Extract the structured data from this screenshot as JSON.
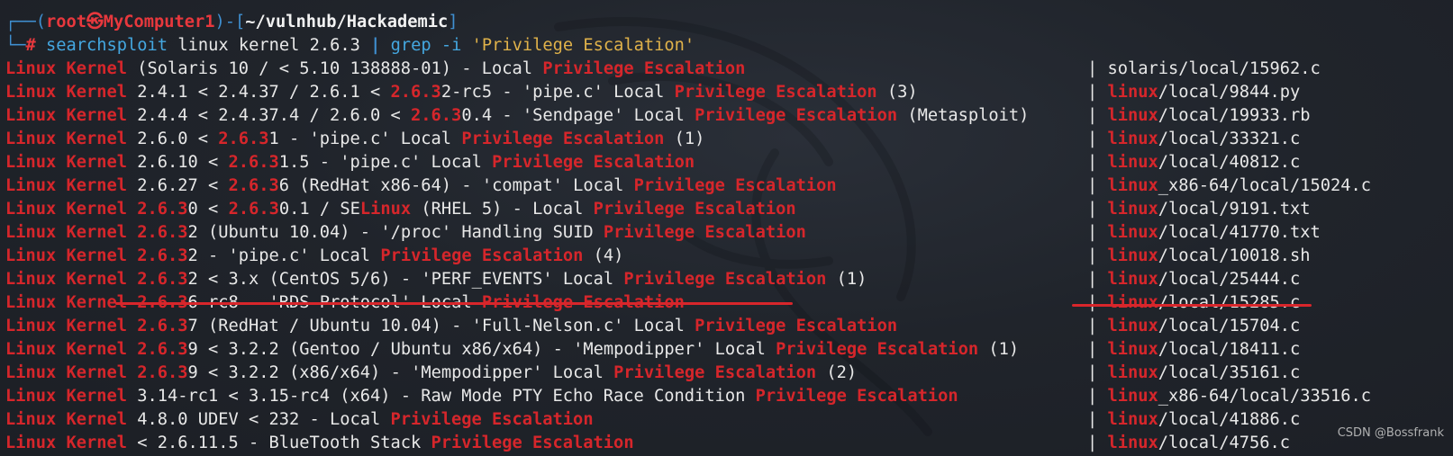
{
  "prompt": {
    "corner_top": "┌──(",
    "user": "root",
    "skull": "㉿",
    "host": "MyComputer1",
    "sep_open": ")-[",
    "cwd": "~/vulnhub/Hackademic",
    "sep_close": "]",
    "corner_bottom": "└─",
    "hash": "#",
    "command": "searchsploit",
    "args": " linux kernel 2.6.3 ",
    "pipe": "|",
    "grep": " grep -i ",
    "pattern": "'Privilege Escalation'"
  },
  "results": [
    {
      "title": [
        [
          "hl",
          "Linux Kernel"
        ],
        [
          "t",
          " (Solaris 10 / < 5.10 138888-01) - Local "
        ],
        [
          "hl",
          "Privilege Escalation"
        ]
      ],
      "path": [
        [
          "t",
          "| solaris/local/15962.c"
        ]
      ]
    },
    {
      "title": [
        [
          "hl",
          "Linux Kernel"
        ],
        [
          "t",
          " 2.4.1 < 2.4.37 / 2.6.1 < "
        ],
        [
          "hl",
          "2.6.3"
        ],
        [
          "t",
          "2-rc5 - 'pipe.c' Local "
        ],
        [
          "hl",
          "Privilege Escalation"
        ],
        [
          "t",
          " (3)"
        ]
      ],
      "path": [
        [
          "t",
          "| "
        ],
        [
          "hl",
          "linux"
        ],
        [
          "t",
          "/local/9844.py"
        ]
      ]
    },
    {
      "title": [
        [
          "hl",
          "Linux Kernel"
        ],
        [
          "t",
          " 2.4.4 < 2.4.37.4 / 2.6.0 < "
        ],
        [
          "hl",
          "2.6.3"
        ],
        [
          "t",
          "0.4 - 'Sendpage' Local "
        ],
        [
          "hl",
          "Privilege Escalation"
        ],
        [
          "t",
          " (Metasploit)"
        ]
      ],
      "path": [
        [
          "t",
          "| "
        ],
        [
          "hl",
          "linux"
        ],
        [
          "t",
          "/local/19933.rb"
        ]
      ]
    },
    {
      "title": [
        [
          "hl",
          "Linux Kernel"
        ],
        [
          "t",
          " 2.6.0 < "
        ],
        [
          "hl",
          "2.6.3"
        ],
        [
          "t",
          "1 - 'pipe.c' Local "
        ],
        [
          "hl",
          "Privilege Escalation"
        ],
        [
          "t",
          " (1)"
        ]
      ],
      "path": [
        [
          "t",
          "| "
        ],
        [
          "hl",
          "linux"
        ],
        [
          "t",
          "/local/33321.c"
        ]
      ]
    },
    {
      "title": [
        [
          "hl",
          "Linux Kernel"
        ],
        [
          "t",
          " 2.6.10 < "
        ],
        [
          "hl",
          "2.6.3"
        ],
        [
          "t",
          "1.5 - 'pipe.c' Local "
        ],
        [
          "hl",
          "Privilege Escalation"
        ]
      ],
      "path": [
        [
          "t",
          "| "
        ],
        [
          "hl",
          "linux"
        ],
        [
          "t",
          "/local/40812.c"
        ]
      ]
    },
    {
      "title": [
        [
          "hl",
          "Linux Kernel"
        ],
        [
          "t",
          " 2.6.27 < "
        ],
        [
          "hl",
          "2.6.3"
        ],
        [
          "t",
          "6 (RedHat x86-64) - 'compat' Local "
        ],
        [
          "hl",
          "Privilege Escalation"
        ]
      ],
      "path": [
        [
          "t",
          "| "
        ],
        [
          "hl",
          "linux"
        ],
        [
          "t",
          "_x86-64/local/15024.c"
        ]
      ]
    },
    {
      "title": [
        [
          "hl",
          "Linux Kernel"
        ],
        [
          "t",
          " "
        ],
        [
          "hl",
          "2.6.3"
        ],
        [
          "t",
          "0 < "
        ],
        [
          "hl",
          "2.6.3"
        ],
        [
          "t",
          "0.1 / SE"
        ],
        [
          "hl",
          "Linux"
        ],
        [
          "t",
          " (RHEL 5) - Local "
        ],
        [
          "hl",
          "Privilege Escalation"
        ]
      ],
      "path": [
        [
          "t",
          "| "
        ],
        [
          "hl",
          "linux"
        ],
        [
          "t",
          "/local/9191.txt"
        ]
      ]
    },
    {
      "title": [
        [
          "hl",
          "Linux Kernel"
        ],
        [
          "t",
          " "
        ],
        [
          "hl",
          "2.6.3"
        ],
        [
          "t",
          "2 (Ubuntu 10.04) - '/proc' Handling SUID "
        ],
        [
          "hl",
          "Privilege Escalation"
        ]
      ],
      "path": [
        [
          "t",
          "| "
        ],
        [
          "hl",
          "linux"
        ],
        [
          "t",
          "/local/41770.txt"
        ]
      ]
    },
    {
      "title": [
        [
          "hl",
          "Linux Kernel"
        ],
        [
          "t",
          " "
        ],
        [
          "hl",
          "2.6.3"
        ],
        [
          "t",
          "2 - 'pipe.c' Local "
        ],
        [
          "hl",
          "Privilege Escalation"
        ],
        [
          "t",
          " (4)"
        ]
      ],
      "path": [
        [
          "t",
          "| "
        ],
        [
          "hl",
          "linux"
        ],
        [
          "t",
          "/local/10018.sh"
        ]
      ]
    },
    {
      "title": [
        [
          "hl",
          "Linux Kernel"
        ],
        [
          "t",
          " "
        ],
        [
          "hl",
          "2.6.3"
        ],
        [
          "t",
          "2 < 3.x (CentOS 5/6) - 'PERF_EVENTS' Local "
        ],
        [
          "hl",
          "Privilege Escalation"
        ],
        [
          "t",
          " (1)"
        ]
      ],
      "path": [
        [
          "t",
          "| "
        ],
        [
          "hl",
          "linux"
        ],
        [
          "t",
          "/local/25444.c"
        ]
      ]
    },
    {
      "title": [
        [
          "hl",
          "Linux Kernel"
        ],
        [
          "t",
          " "
        ],
        [
          "hl",
          "2.6.3"
        ],
        [
          "t",
          "6-rc8 - 'RDS Protocol' Local "
        ],
        [
          "hl",
          "Privilege Escalation"
        ]
      ],
      "path": [
        [
          "t",
          "| "
        ],
        [
          "hl",
          "linux"
        ],
        [
          "t",
          "/local/15285.c"
        ]
      ]
    },
    {
      "title": [
        [
          "hl",
          "Linux Kernel"
        ],
        [
          "t",
          " "
        ],
        [
          "hl",
          "2.6.3"
        ],
        [
          "t",
          "7 (RedHat / Ubuntu 10.04) - 'Full-Nelson.c' Local "
        ],
        [
          "hl",
          "Privilege Escalation"
        ]
      ],
      "path": [
        [
          "t",
          "| "
        ],
        [
          "hl",
          "linux"
        ],
        [
          "t",
          "/local/15704.c"
        ]
      ]
    },
    {
      "title": [
        [
          "hl",
          "Linux Kernel"
        ],
        [
          "t",
          " "
        ],
        [
          "hl",
          "2.6.3"
        ],
        [
          "t",
          "9 < 3.2.2 (Gentoo / Ubuntu x86/x64) - 'Mempodipper' Local "
        ],
        [
          "hl",
          "Privilege Escalation"
        ],
        [
          "t",
          " (1)"
        ]
      ],
      "path": [
        [
          "t",
          "| "
        ],
        [
          "hl",
          "linux"
        ],
        [
          "t",
          "/local/18411.c"
        ]
      ]
    },
    {
      "title": [
        [
          "hl",
          "Linux Kernel"
        ],
        [
          "t",
          " "
        ],
        [
          "hl",
          "2.6.3"
        ],
        [
          "t",
          "9 < 3.2.2 (x86/x64) - 'Mempodipper' Local "
        ],
        [
          "hl",
          "Privilege Escalation"
        ],
        [
          "t",
          " (2)"
        ]
      ],
      "path": [
        [
          "t",
          "| "
        ],
        [
          "hl",
          "linux"
        ],
        [
          "t",
          "/local/35161.c"
        ]
      ]
    },
    {
      "title": [
        [
          "hl",
          "Linux Kernel"
        ],
        [
          "t",
          " 3.14-rc1 < 3.15-rc4 (x64) - Raw Mode PTY Echo Race Condition "
        ],
        [
          "hl",
          "Privilege Escalation"
        ]
      ],
      "path": [
        [
          "t",
          "| "
        ],
        [
          "hl",
          "linux"
        ],
        [
          "t",
          "_x86-64/local/33516.c"
        ]
      ]
    },
    {
      "title": [
        [
          "hl",
          "Linux Kernel"
        ],
        [
          "t",
          " 4.8.0 UDEV < 232 - Local "
        ],
        [
          "hl",
          "Privilege Escalation"
        ]
      ],
      "path": [
        [
          "t",
          "| "
        ],
        [
          "hl",
          "linux"
        ],
        [
          "t",
          "/local/41886.c"
        ]
      ]
    },
    {
      "title": [
        [
          "hl",
          "Linux Kernel"
        ],
        [
          "t",
          " < 2.6.11.5 - BlueTooth Stack "
        ],
        [
          "hl",
          "Privilege Escalation"
        ]
      ],
      "path": [
        [
          "t",
          "| "
        ],
        [
          "hl",
          "linux"
        ],
        [
          "t",
          "/local/4756.c"
        ]
      ]
    }
  ],
  "watermark": "CSDN @Bossfrank",
  "colors": {
    "highlight": "#d6262b",
    "prompt_blue": "#3f8fd0",
    "text": "#e8e8e8",
    "string_yellow": "#e0b24a",
    "annotation_red": "#d8262b"
  }
}
